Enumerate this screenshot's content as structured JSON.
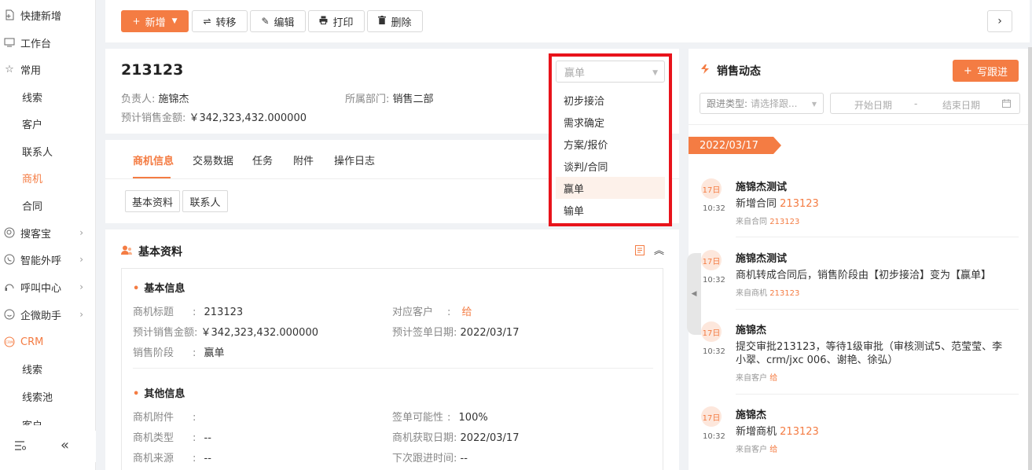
{
  "sidebar": {
    "items": [
      {
        "label": "快捷新增",
        "icon": "add-file-icon"
      },
      {
        "label": "工作台",
        "icon": "monitor-icon"
      },
      {
        "label": "常用",
        "icon": "star-icon"
      },
      {
        "label": "线索"
      },
      {
        "label": "客户"
      },
      {
        "label": "联系人"
      },
      {
        "label": "商机"
      },
      {
        "label": "合同"
      },
      {
        "label": "搜客宝",
        "icon": "search-circle-icon"
      },
      {
        "label": "智能外呼",
        "icon": "phone-circle-icon"
      },
      {
        "label": "呼叫中心",
        "icon": "call-center-icon"
      },
      {
        "label": "企微助手",
        "icon": "chat-icon"
      },
      {
        "label": "CRM",
        "icon": "crm-icon"
      },
      {
        "label": "线索"
      },
      {
        "label": "线索池"
      },
      {
        "label": "客户"
      }
    ]
  },
  "toolbar": {
    "add": "新增",
    "transfer": "转移",
    "edit": "编辑",
    "print": "打印",
    "delete": "删除"
  },
  "header": {
    "title": "213123",
    "owner_label": "负责人:",
    "owner": "施锦杰",
    "dept_label": "所属部门:",
    "dept": "销售二部",
    "amount_label": "预计销售金额:",
    "amount": "￥342,323,432.000000"
  },
  "stage_dropdown": {
    "selected": "赢单",
    "options": [
      "初步接洽",
      "需求确定",
      "方案/报价",
      "谈判/合同",
      "赢单",
      "输单"
    ]
  },
  "tabs": [
    "商机信息",
    "交易数据",
    "任务",
    "附件",
    "操作日志"
  ],
  "subtabs": [
    "基本资料",
    "联系人"
  ],
  "basic": {
    "title": "基本资料",
    "group1": "基本信息",
    "group2": "其他信息",
    "rows": {
      "name_k": "商机标题",
      "name_v": "213123",
      "customer_k": "对应客户",
      "customer_v": "给",
      "amount_k": "预计销售金额:",
      "amount_v": "￥342,323,432.000000",
      "sign_date_k": "预计签单日期:",
      "sign_date_v": "2022/03/17",
      "stage_k": "销售阶段",
      "stage_v": "赢单",
      "attach_k": "商机附件",
      "attach_v": "",
      "prob_k": "签单可能性",
      "prob_v": "100%",
      "type_k": "商机类型",
      "type_v": "--",
      "get_date_k": "商机获取日期:",
      "get_date_v": "2022/03/17",
      "source_k": "商机来源",
      "source_v": "--",
      "next_k": "下次跟进时间:",
      "next_v": "--"
    }
  },
  "sales": {
    "title": "销售动态",
    "write_btn": "写跟进",
    "filter_label": "跟进类型:",
    "filter_placeholder": "请选择跟...",
    "start_date": "开始日期",
    "date_sep": "-",
    "end_date": "结束日期",
    "date_tag": "2022/03/17",
    "activities": [
      {
        "day": "17日",
        "time": "10:32",
        "who": "施锦杰测试",
        "desc": "新增合同",
        "desc_link": "213123",
        "src": "来自合同",
        "src_link": "213123"
      },
      {
        "day": "17日",
        "time": "10:32",
        "who": "施锦杰测试",
        "desc": "商机转成合同后，销售阶段由【初步接洽】变为【赢单】",
        "desc_link": "",
        "src": "来自商机",
        "src_link": "213123"
      },
      {
        "day": "17日",
        "time": "10:32",
        "who": "施锦杰",
        "desc": "提交审批213123，等待1级审批（审核测试5、范莹莹、李小翠、crm/jxc 006、谢艳、徐弘）",
        "desc_link": "",
        "src": "来自客户",
        "src_link": "给"
      },
      {
        "day": "17日",
        "time": "10:32",
        "who": "施锦杰",
        "desc": "新增商机",
        "desc_link": "213123",
        "src": "来自客户",
        "src_link": "给"
      }
    ]
  },
  "colors": {
    "accent": "#f47c43",
    "highlight_border": "#e8131b"
  }
}
